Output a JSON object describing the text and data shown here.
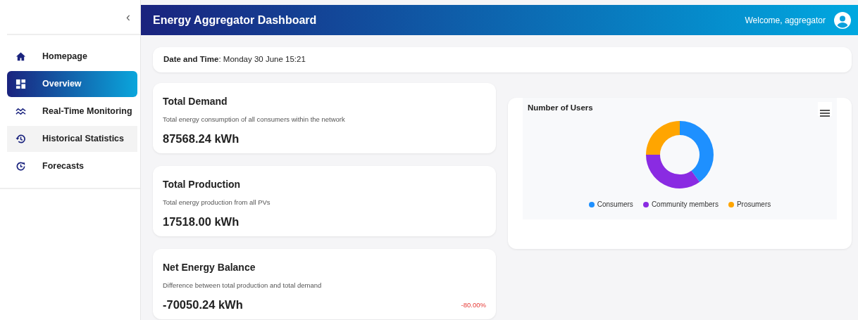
{
  "sidebar": {
    "collapse_icon": "‹",
    "items": [
      {
        "kind": "home",
        "label": "Homepage",
        "selected": false,
        "hovered": false
      },
      {
        "kind": "overview",
        "label": "Overview",
        "selected": true,
        "hovered": false
      },
      {
        "kind": "monitoring",
        "label": "Real-Time Monitoring",
        "selected": false,
        "hovered": false
      },
      {
        "kind": "history",
        "label": "Historical Statistics",
        "selected": false,
        "hovered": true
      },
      {
        "kind": "forecast",
        "label": "Forecasts",
        "selected": false,
        "hovered": false
      }
    ]
  },
  "header": {
    "title": "Energy Aggregator Dashboard",
    "welcome": "Welcome, aggregator"
  },
  "datetime": {
    "text": "**Date and Time**: Monday 30 June 15:21"
  },
  "metrics": [
    {
      "title": "Total Demand",
      "description": "Total energy consumption of all consumers within the network",
      "value": "87568.24 kWh"
    },
    {
      "title": "Total Production",
      "description": "Total energy production from all PVs",
      "value": "17518.00 kWh"
    },
    {
      "title": "Net Energy Balance",
      "description": "Difference between total production and total demand",
      "value": "-70050.24 kWh",
      "change": "-80.00%"
    }
  ],
  "users_chart": {
    "title": "Number of Users",
    "legend": [
      {
        "label": "Consumers",
        "color": "#1e90ff"
      },
      {
        "label": "Community members",
        "color": "#8a2be2"
      },
      {
        "label": "Prosumers",
        "color": "#ffa500"
      }
    ]
  }
}
